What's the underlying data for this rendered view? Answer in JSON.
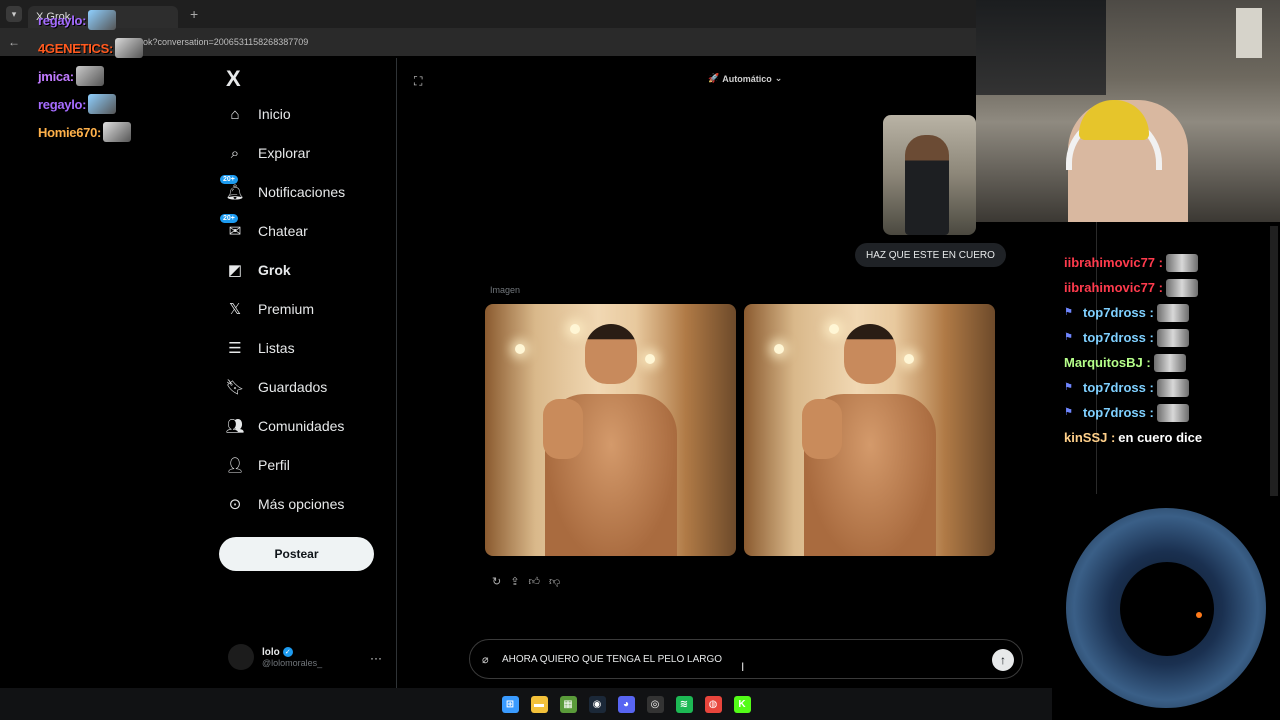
{
  "browser": {
    "tab_label": "X  Grok",
    "new_tab_symbol": "+",
    "url": "rok?conversation=2006531158268387709"
  },
  "overlay_chat": [
    {
      "name": "regaylo:",
      "color": "#a56cff"
    },
    {
      "name": "4GENETICS:",
      "color": "#ff5a1f"
    },
    {
      "name": "jmica:",
      "color": "#c07bff"
    },
    {
      "name": "regaylo:",
      "color": "#a56cff"
    },
    {
      "name": "Homie670:",
      "color": "#ffb14a"
    }
  ],
  "sidebar": {
    "logo": "X",
    "items": [
      {
        "label": "Inicio",
        "icon": "home-icon"
      },
      {
        "label": "Explorar",
        "icon": "search-icon"
      },
      {
        "label": "Notificaciones",
        "icon": "bell-icon",
        "badge": "20+"
      },
      {
        "label": "Chatear",
        "icon": "mail-icon",
        "badge": "20+"
      },
      {
        "label": "Grok",
        "icon": "grok-icon"
      },
      {
        "label": "Premium",
        "icon": "x-premium-icon"
      },
      {
        "label": "Listas",
        "icon": "list-icon"
      },
      {
        "label": "Guardados",
        "icon": "bookmark-icon"
      },
      {
        "label": "Comunidades",
        "icon": "communities-icon"
      },
      {
        "label": "Perfil",
        "icon": "user-icon"
      },
      {
        "label": "Más opciones",
        "icon": "more-circle-icon"
      }
    ],
    "post_button": "Postear",
    "profile": {
      "name": "lolo",
      "handle": "@lolomorales_"
    }
  },
  "grok": {
    "mode": "Automático",
    "user_message": "HAZ QUE ESTE EN CUERO",
    "image_label": "Imagen",
    "input_value": "AHORA QUIERO QUE TENGA EL PELO LARGO"
  },
  "right_chat": [
    {
      "name": "iibrahimovic77 :",
      "color": "#ff3b4d",
      "badge": false,
      "emote": true
    },
    {
      "name": "iibrahimovic77 :",
      "color": "#ff3b4d",
      "badge": false,
      "emote": true
    },
    {
      "name": "top7dross :",
      "color": "#7fd0ff",
      "badge": true,
      "emote": true
    },
    {
      "name": "top7dross :",
      "color": "#7fd0ff",
      "badge": true,
      "emote": true
    },
    {
      "name": "MarquitosBJ :",
      "color": "#b6ff8a",
      "badge": false,
      "emote": true
    },
    {
      "name": "top7dross :",
      "color": "#7fd0ff",
      "badge": true,
      "emote": true
    },
    {
      "name": "top7dross :",
      "color": "#7fd0ff",
      "badge": true,
      "emote": true
    },
    {
      "name": "kinSSJ :",
      "color": "#ffd08a",
      "badge": false,
      "emote": false,
      "text": "en cuero dice"
    }
  ],
  "taskbar": [
    "windows-icon",
    "folder-icon",
    "minecraft-icon",
    "steam-icon",
    "discord-icon",
    "obs-icon",
    "spotify-icon",
    "chrome-icon",
    "kick-icon"
  ]
}
